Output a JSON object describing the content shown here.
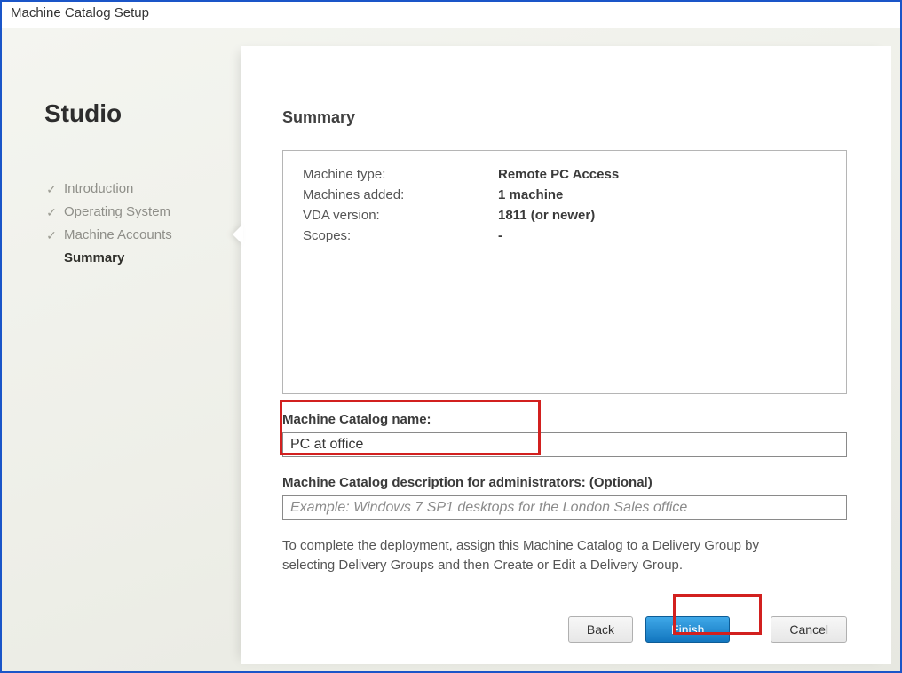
{
  "window": {
    "title": "Machine Catalog Setup"
  },
  "sidebar": {
    "brand": "Studio",
    "items": [
      {
        "label": "Introduction",
        "completed": true
      },
      {
        "label": "Operating System",
        "completed": true
      },
      {
        "label": "Machine Accounts",
        "completed": true
      },
      {
        "label": "Summary",
        "current": true
      }
    ]
  },
  "main": {
    "heading": "Summary",
    "rows": [
      {
        "label": "Machine type:",
        "value": "Remote PC Access"
      },
      {
        "label": "Machines added:",
        "value": "1 machine"
      },
      {
        "label": "VDA version:",
        "value": "1811 (or newer)"
      },
      {
        "label": "Scopes:",
        "value": "-"
      }
    ],
    "name_label": "Machine Catalog name:",
    "name_value": "PC at office",
    "desc_label": "Machine Catalog description for administrators: (Optional)",
    "desc_placeholder": "Example: Windows 7 SP1 desktops for the London Sales office",
    "help_text": "To complete the deployment, assign this Machine Catalog to a Delivery Group by selecting Delivery Groups and then Create or Edit a Delivery Group.",
    "buttons": {
      "back": "Back",
      "finish": "Finish",
      "cancel": "Cancel"
    }
  }
}
